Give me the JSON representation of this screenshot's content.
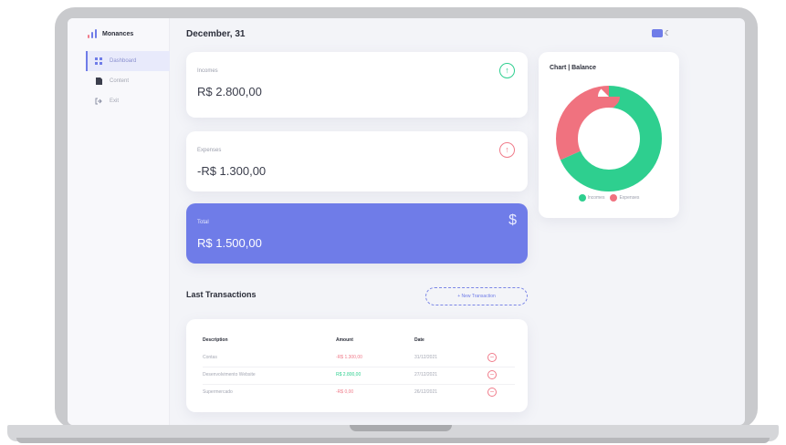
{
  "app": {
    "name": "Monances"
  },
  "sidebar": {
    "items": [
      {
        "label": "Dashboard",
        "icon": "grid-icon",
        "active": true
      },
      {
        "label": "Content",
        "icon": "document-icon",
        "active": false
      },
      {
        "label": "Exit",
        "icon": "exit-icon",
        "active": false
      }
    ]
  },
  "header": {
    "date": "December, 31"
  },
  "cards": {
    "incomes": {
      "label": "Incomes",
      "value": "R$ 2.800,00"
    },
    "expenses": {
      "label": "Expenses",
      "value": "-R$ 1.300,00"
    },
    "total": {
      "label": "Total",
      "value": "R$ 1.500,00",
      "symbol": "$"
    }
  },
  "chart": {
    "title": "Chart | Balance",
    "legend": [
      "Incomes",
      "Expenses"
    ]
  },
  "chart_data": {
    "type": "pie",
    "categories": [
      "Incomes",
      "Expenses"
    ],
    "values": [
      2800,
      1300
    ],
    "colors": [
      "#2ecf8f",
      "#f0727f"
    ],
    "legend_position": "bottom"
  },
  "transactions": {
    "title": "Last Transactions",
    "new_button": "+ New Transaction",
    "columns": [
      "Description",
      "Amount",
      "Date"
    ],
    "rows": [
      {
        "description": "Contas",
        "amount": "-R$ 1.300,00",
        "date": "31/12/2021",
        "kind": "neg"
      },
      {
        "description": "Desenvolvimento Website",
        "amount": "R$ 2.800,00",
        "date": "27/12/2021",
        "kind": "pos"
      },
      {
        "description": "Supermercado",
        "amount": "-R$ 0,00",
        "date": "26/12/2021",
        "kind": "neg"
      }
    ]
  },
  "colors": {
    "accent": "#6f7ce8",
    "income": "#2ecf8f",
    "expense": "#f0727f"
  }
}
